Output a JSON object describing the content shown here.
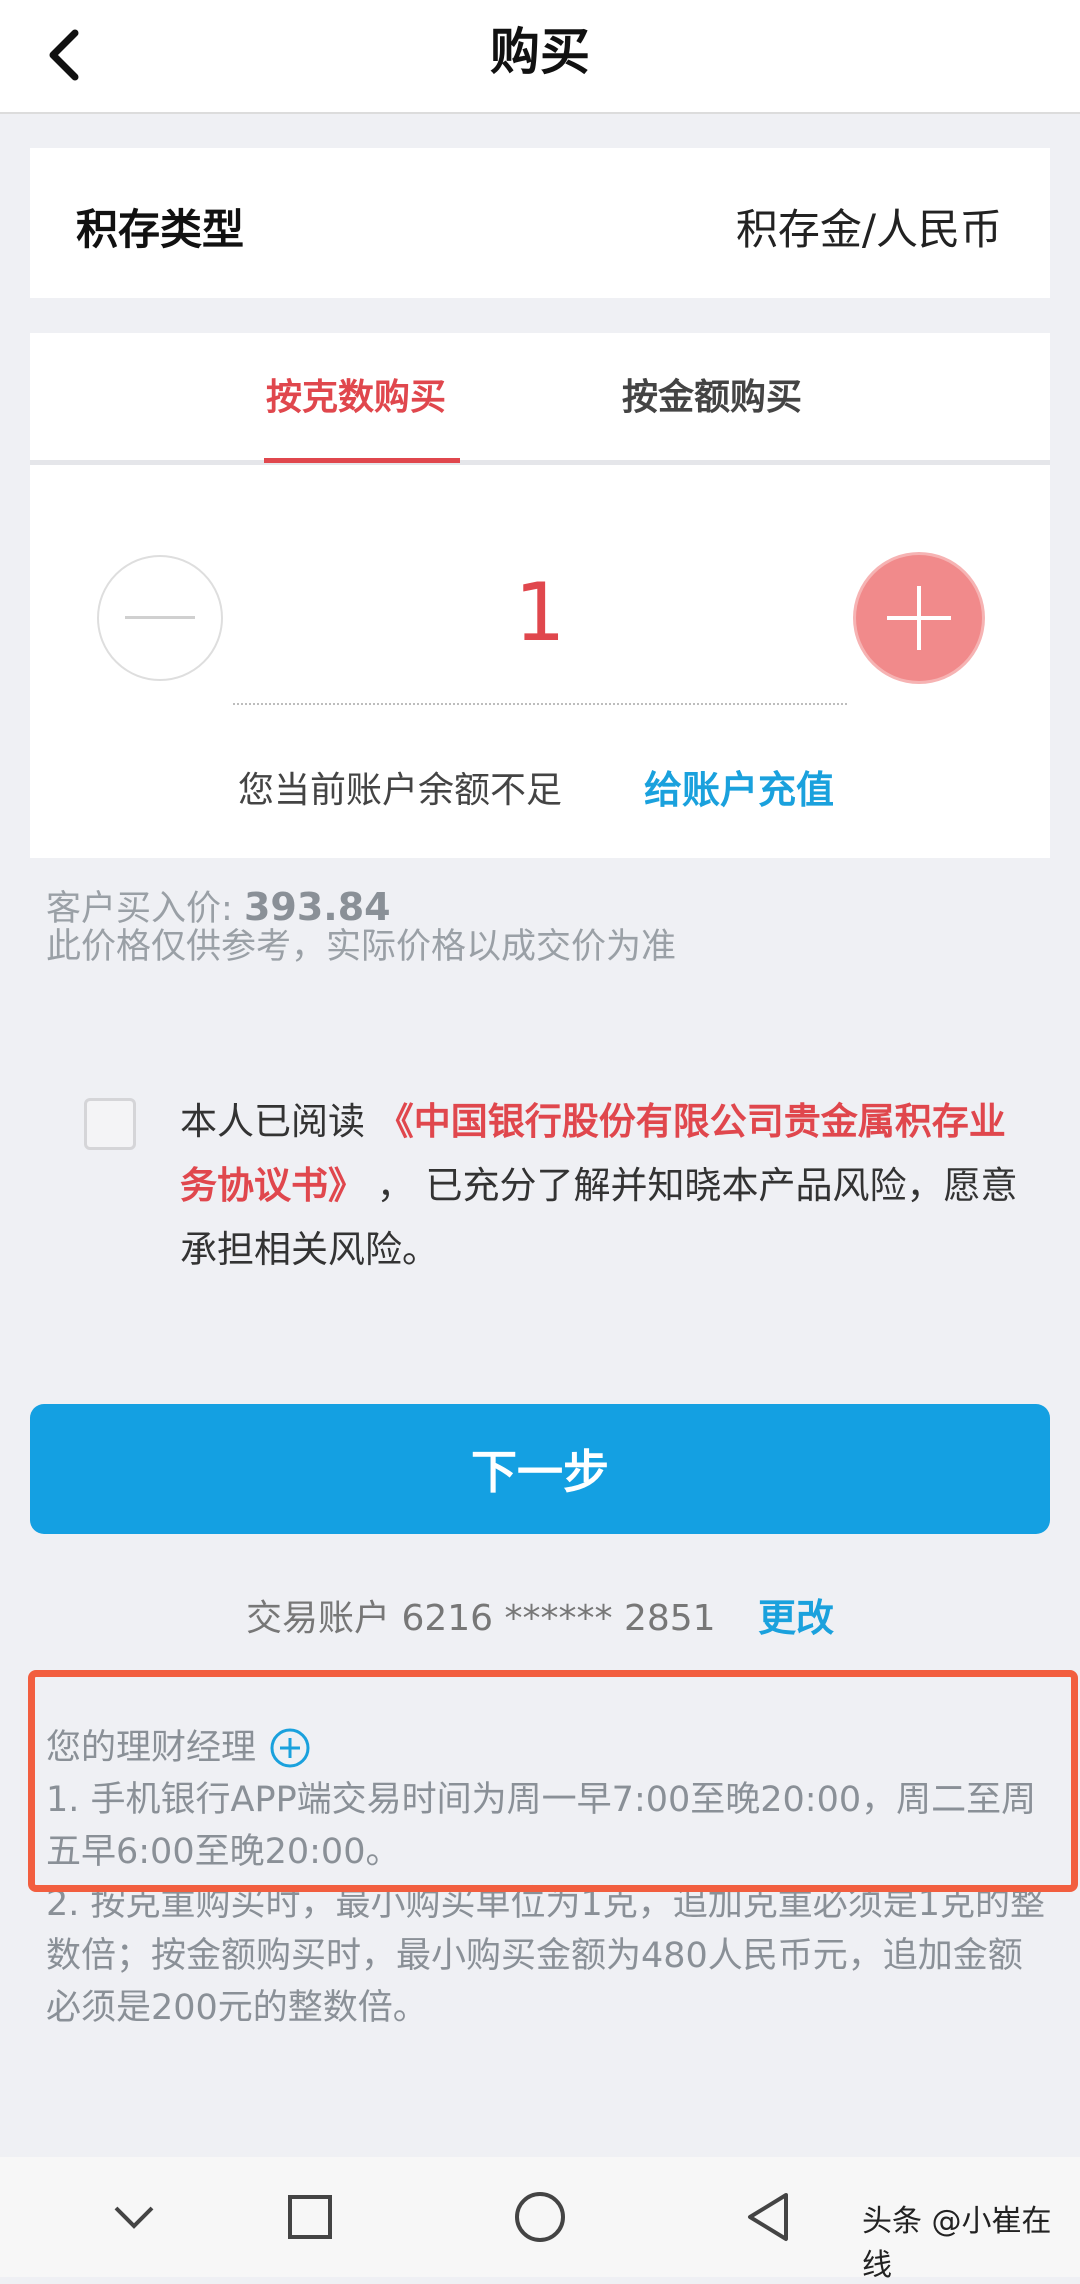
{
  "header": {
    "title": "购买",
    "back_icon": "chevron-left-icon"
  },
  "type_card": {
    "label": "积存类型",
    "value": "积存金/人民币"
  },
  "tabs": [
    {
      "label": "按克数购买",
      "active": true
    },
    {
      "label": "按金额购买",
      "active": false
    }
  ],
  "stepper": {
    "value": "1",
    "minus_icon": "minus-icon",
    "plus_icon": "plus-icon"
  },
  "balance": {
    "message": "您当前账户余额不足",
    "topup_label": "给账户充值"
  },
  "price": {
    "label": "客户买入价:",
    "value": "393.84",
    "note": "此价格仅供参考，实际价格以成交价为准"
  },
  "agreement": {
    "prefix": "本人已阅读",
    "title": "《中国银行股份有限公司贵金属积存业务协议书》",
    "suffix": "，   已充分了解并知晓本产品风险，愿意承担相关风险。",
    "checked": false
  },
  "next_button": {
    "label": "下一步"
  },
  "account": {
    "label": "交易账户 6216 ****** 2851",
    "change_label": "更改"
  },
  "notes": {
    "manager_label": "您的理财经理",
    "manager_icon": "plus-circle-icon",
    "items": [
      "1. 手机银行APP端交易时间为周一早7:00至晚20:00，周二至周五早6:00至晚20:00。",
      "2. 按克重购买时，最小购买单位为1克，追加克重必须是1克的整数倍；按金额购买时，最小购买金额为480人民币元，追加金额必须是200元的整数倍。"
    ]
  },
  "nav": {
    "back": "chevron-down-icon",
    "home": "square-icon",
    "circle": "circle-icon",
    "triangle": "triangle-back-icon"
  },
  "watermark": "头条 @小崔在线",
  "colors": {
    "accent_red": "#e0474d",
    "accent_blue": "#14a0e2",
    "link_blue": "#1aa1dd",
    "highlight": "#f25e3f"
  }
}
